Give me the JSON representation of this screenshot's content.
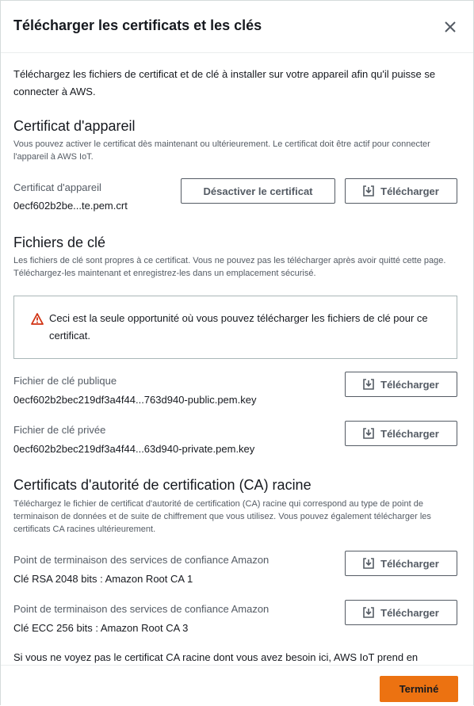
{
  "modal": {
    "title": "Télécharger les certificats et les clés",
    "intro": "Téléchargez les fichiers de certificat et de clé à installer sur votre appareil afin qu'il puisse se connecter à AWS."
  },
  "device_cert": {
    "heading": "Certificat d'appareil",
    "desc": "Vous pouvez activer le certificat dès maintenant ou ultérieurement. Le certificat doit être actif pour connecter l'appareil à AWS IoT.",
    "label": "Certificat d'appareil",
    "value": "0ecf602b2be...te.pem.crt",
    "deactivate_label": "Désactiver le certificat",
    "download_label": "Télécharger"
  },
  "key_files": {
    "heading": "Fichiers de clé",
    "desc": "Les fichiers de clé sont propres à ce certificat. Vous ne pouvez pas les télécharger après avoir quitté cette page. Téléchargez-les maintenant et enregistrez-les dans un emplacement sécurisé.",
    "alert_text": "Ceci est la seule opportunité où vous pouvez télécharger les fichiers de clé pour ce certificat.",
    "public_label": "Fichier de clé publique",
    "public_value": "0ecf602b2bec219df3a4f44...763d940-public.pem.key",
    "private_label": "Fichier de clé privée",
    "private_value": "0ecf602b2bec219df3a4f44...63d940-private.pem.key",
    "download_label": "Télécharger"
  },
  "ca": {
    "heading": "Certificats d'autorité de certification (CA) racine",
    "desc": "Téléchargez le fichier de certificat d'autorité de certification (CA) racine qui correspond au type de point de terminaison de données et de suite de chiffrement que vous utilisez. Vous pouvez également télécharger les certificats CA racines ultérieurement.",
    "items": [
      {
        "label": "Point de terminaison des services de confiance Amazon",
        "value": "Clé RSA 2048 bits : Amazon Root CA 1"
      },
      {
        "label": "Point de terminaison des services de confiance Amazon",
        "value": "Clé ECC 256 bits : Amazon Root CA 3"
      }
    ],
    "download_label": "Télécharger",
    "trailing_text": "Si vous ne voyez pas le certificat CA racine dont vous avez besoin ici, AWS IoT prend en"
  },
  "footer": {
    "done_label": "Terminé"
  },
  "colors": {
    "primary": "#ec7211",
    "warning": "#d13212",
    "text": "#16191f",
    "muted": "#545b64"
  },
  "icons": [
    "close-icon",
    "download-icon",
    "warning-icon"
  ]
}
